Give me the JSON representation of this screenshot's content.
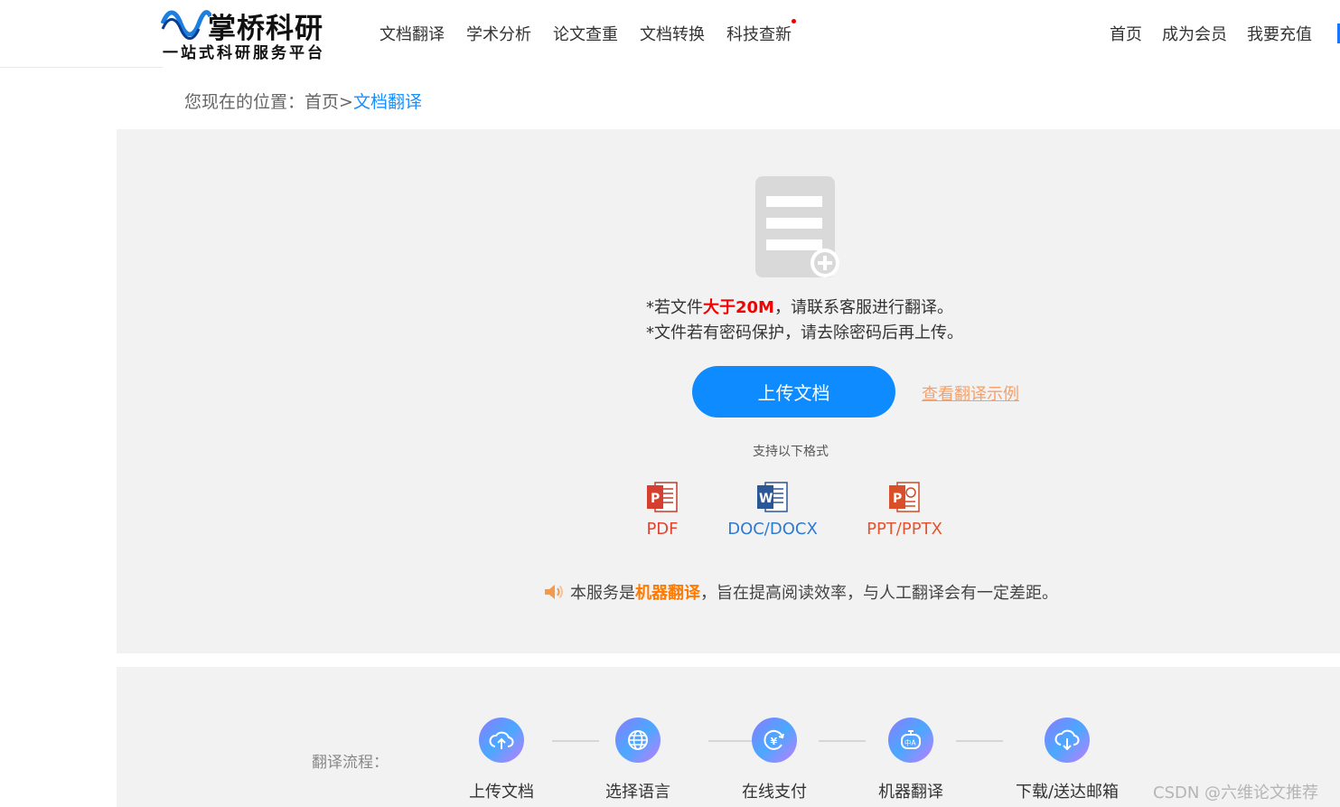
{
  "brand": {
    "name": "掌桥科研",
    "slogan": "一站式科研服务平台",
    "colors": {
      "wave_blue": "#1a7fe0",
      "wave_dark": "#0b3c8c"
    }
  },
  "nav": {
    "items": [
      "文档翻译",
      "学术分析",
      "论文查重",
      "文档转换",
      "科技查新"
    ],
    "right_items": [
      "首页",
      "成为会员",
      "我要充值"
    ]
  },
  "breadcrumb": {
    "prefix": "您现在的位置：",
    "home": "首页",
    "separator": ">",
    "current": "文档翻译"
  },
  "upload": {
    "icon": "document-add-icon",
    "note1": {
      "before": "*若文件",
      "highlight": "大于20M",
      "after": "，请联系客服进行翻译。"
    },
    "note2": "*文件若有密码保护，请去除密码后再上传。",
    "button_label": "上传文档",
    "example_link": "查看翻译示例",
    "formats_title": "支持以下格式",
    "formats": [
      {
        "label": "PDF",
        "icon": "pdf-file-icon",
        "color": "#e2432f"
      },
      {
        "label": "DOC/DOCX",
        "icon": "word-file-icon",
        "color": "#2b7bd6"
      },
      {
        "label": "PPT/PPTX",
        "icon": "ppt-file-icon",
        "color": "#e2552f"
      }
    ],
    "notice": {
      "before": "本服务是",
      "highlight": "机器翻译",
      "after": "，旨在提高阅读效率，与人工翻译会有一定差距。"
    }
  },
  "flow": {
    "title": "翻译流程：",
    "steps": [
      {
        "label": "上传文档",
        "icon": "cloud-upload-icon"
      },
      {
        "label": "选择语言",
        "icon": "globe-icon"
      },
      {
        "label": "在线支付",
        "icon": "yuan-payment-icon"
      },
      {
        "label": "机器翻译",
        "icon": "robot-translate-icon"
      },
      {
        "label": "下载/送达邮箱",
        "icon": "cloud-download-icon"
      }
    ]
  },
  "watermark": "CSDN @六维论文推荐"
}
